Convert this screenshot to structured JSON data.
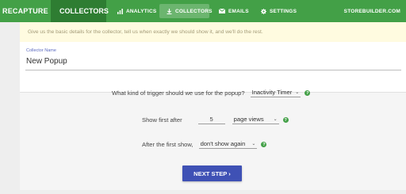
{
  "topbar": {
    "brand": "RECAPTURE",
    "section": "COLLECTORS",
    "nav": [
      {
        "label": "ANALYTICS",
        "icon": "bar-chart-icon"
      },
      {
        "label": "COLLECTORS",
        "icon": "download-icon",
        "active": true
      },
      {
        "label": "EMAILS",
        "icon": "email-icon"
      },
      {
        "label": "SETTINGS",
        "icon": "gear-icon"
      }
    ],
    "store": "STOREBUILDER.COM"
  },
  "info": "Give us the basic details for the collector, tell us when exactly we should show it, and we'll do the rest.",
  "collector": {
    "label": "Collector Name",
    "value": "New Popup"
  },
  "trigger": {
    "question": "What kind of trigger should we use for the popup?",
    "value": "Inactivity Timer"
  },
  "show_first": {
    "label": "Show first after",
    "count": "5",
    "unit": "page views"
  },
  "after_first": {
    "label": "After the first show,",
    "value": "don't show again"
  },
  "next_button": "NEXT STEP ›",
  "colors": {
    "green": "#43a047",
    "dark_green": "#2e7d32",
    "button": "#3f51b5",
    "info_bg": "#fffbe0"
  }
}
